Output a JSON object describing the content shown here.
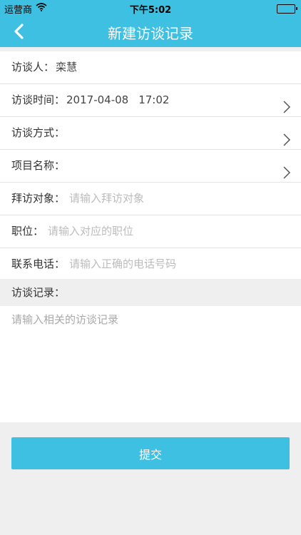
{
  "status": {
    "carrier": "运营商",
    "time": "下午5:02"
  },
  "header": {
    "title": "新建访谈记录"
  },
  "form": {
    "interviewer": {
      "label": "访谈人：",
      "value": "栾慧"
    },
    "time": {
      "label": "访谈时间：",
      "date": "2017-04-08",
      "clock": "17:02"
    },
    "method": {
      "label": "访谈方式："
    },
    "project": {
      "label": "项目名称："
    },
    "visit_target": {
      "label": "拜访对象：",
      "placeholder": "请输入拜访对象"
    },
    "position": {
      "label": "职位：",
      "placeholder": "请输入对应的职位"
    },
    "phone": {
      "label": "联系电话：",
      "placeholder": "请输入正确的电话号码"
    }
  },
  "notes": {
    "label": "访谈记录：",
    "placeholder": "请输入相关的访谈记录"
  },
  "submit": {
    "label": "提交"
  },
  "colors": {
    "accent": "#3ec0e2",
    "background": "#efefef"
  }
}
